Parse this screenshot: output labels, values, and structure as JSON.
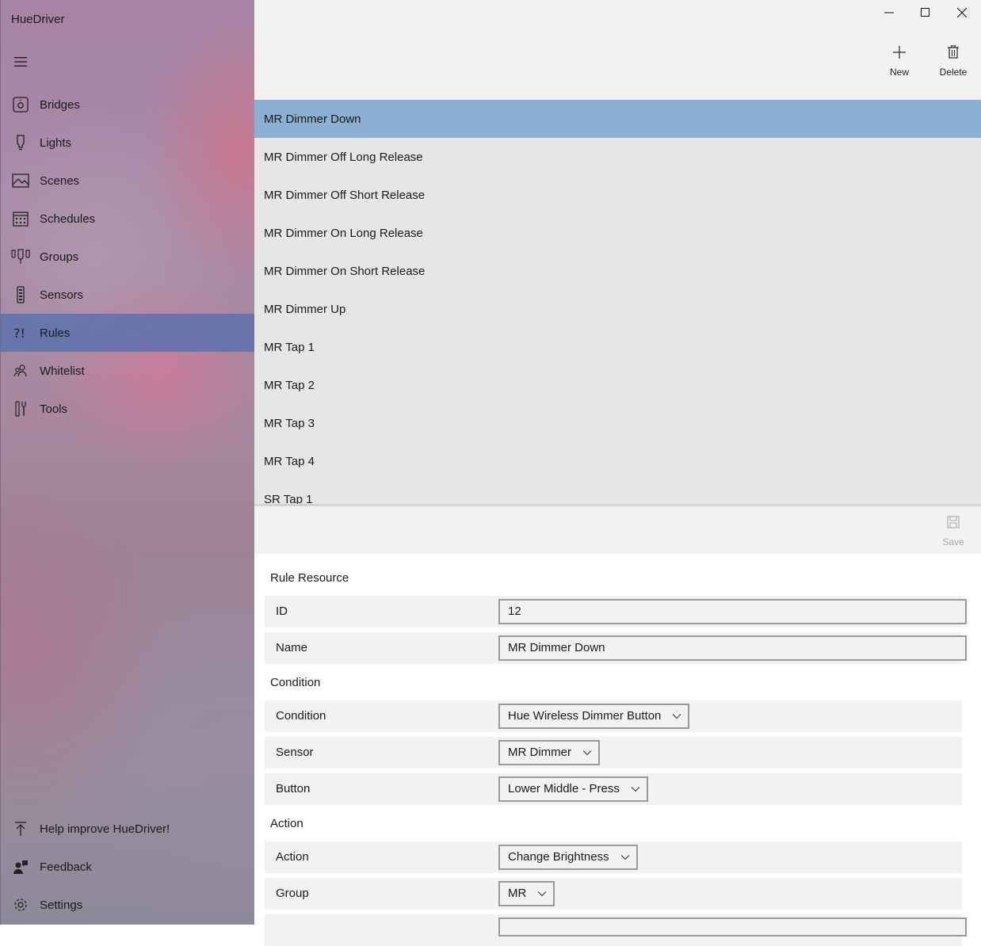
{
  "app": {
    "title": "HueDriver"
  },
  "nav": {
    "items": [
      {
        "label": "Bridges",
        "icon": "bridge-icon"
      },
      {
        "label": "Lights",
        "icon": "bulb-icon"
      },
      {
        "label": "Scenes",
        "icon": "image-icon"
      },
      {
        "label": "Schedules",
        "icon": "calendar-icon"
      },
      {
        "label": "Groups",
        "icon": "group-icon"
      },
      {
        "label": "Sensors",
        "icon": "remote-icon"
      },
      {
        "label": "Rules",
        "icon": "rules-icon"
      },
      {
        "label": "Whitelist",
        "icon": "people-icon"
      },
      {
        "label": "Tools",
        "icon": "tools-icon"
      }
    ],
    "selected": "Rules",
    "bottom": [
      {
        "label": "Help improve HueDriver!",
        "icon": "upload-icon"
      },
      {
        "label": "Feedback",
        "icon": "feedback-icon"
      },
      {
        "label": "Settings",
        "icon": "gear-icon"
      }
    ]
  },
  "commands": {
    "new_label": "New",
    "delete_label": "Delete",
    "save_label": "Save"
  },
  "rules_list": [
    "MR Dimmer Down",
    "MR Dimmer Off Long Release",
    "MR Dimmer Off Short Release",
    "MR Dimmer On Long Release",
    "MR Dimmer On Short Release",
    "MR Dimmer Up",
    "MR Tap 1",
    "MR Tap 2",
    "MR Tap 3",
    "MR Tap 4",
    "SR Tap 1"
  ],
  "form": {
    "rule_resource_title": "Rule Resource",
    "id_label": "ID",
    "id_value": "12",
    "name_label": "Name",
    "name_value": "MR Dimmer Down",
    "condition_title": "Condition",
    "condition_label": "Condition",
    "condition_value": "Hue Wireless Dimmer Button",
    "sensor_label": "Sensor",
    "sensor_value": "MR Dimmer",
    "button_label": "Button",
    "button_value": "Lower Middle - Press",
    "action_title": "Action",
    "action_label": "Action",
    "action_value": "Change Brightness",
    "group_label": "Group",
    "group_value": "MR"
  }
}
